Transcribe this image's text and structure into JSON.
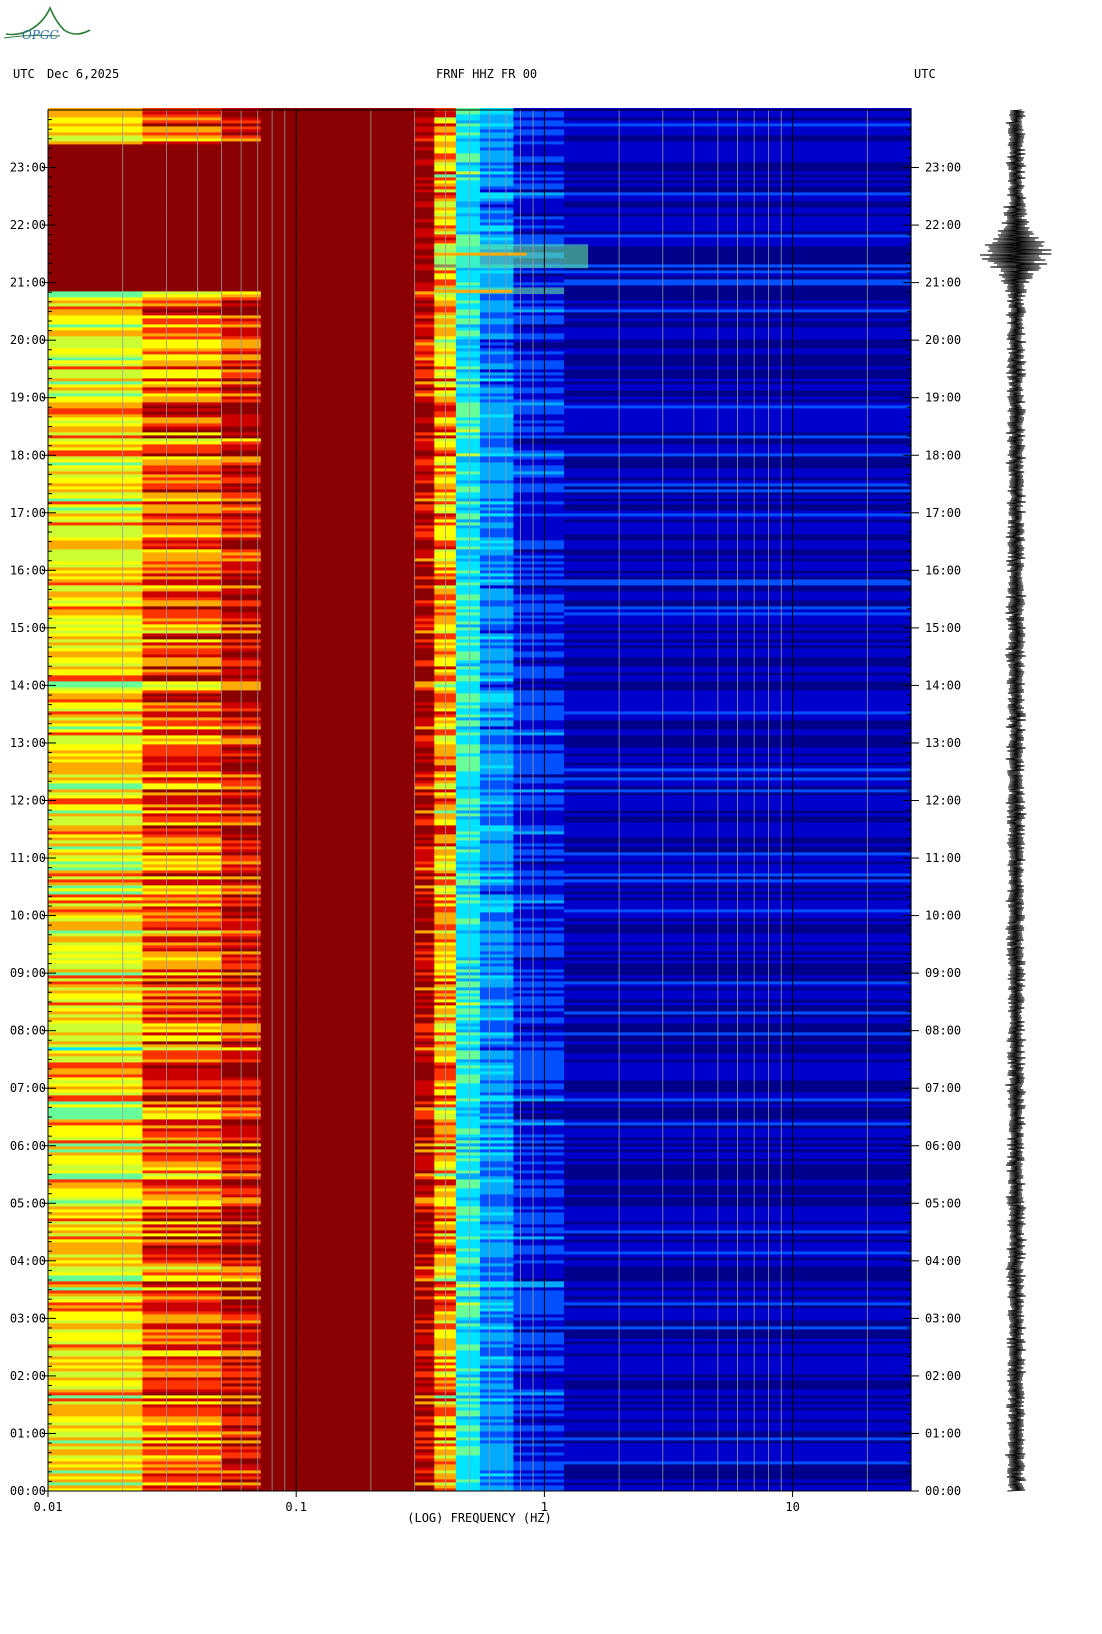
{
  "logo": {
    "text": "OPGC",
    "color": "#2f7d3a"
  },
  "header": {
    "left_tz": "UTC",
    "date": "Dec 6,2025",
    "station": "FRNF HHZ FR 00",
    "right_tz": "UTC"
  },
  "chart_data": {
    "type": "heatmap",
    "title": "FRNF HHZ FR 00",
    "date": "Dec 6,2025",
    "xlabel": "(LOG) FREQUENCY (HZ)",
    "xscale": "log",
    "xlim": [
      0.01,
      30
    ],
    "x_tick_labels": [
      {
        "value": 0.01,
        "label": "0.01"
      },
      {
        "value": 0.1,
        "label": "0.1"
      },
      {
        "value": 1,
        "label": "1"
      },
      {
        "value": 10,
        "label": "10"
      }
    ],
    "ylabel_left": "UTC",
    "ylabel_right": "UTC",
    "ylim_hours": [
      0,
      24
    ],
    "y_tick_labels": [
      "00:00",
      "01:00",
      "02:00",
      "03:00",
      "04:00",
      "05:00",
      "06:00",
      "07:00",
      "08:00",
      "09:00",
      "10:00",
      "11:00",
      "12:00",
      "13:00",
      "14:00",
      "15:00",
      "16:00",
      "17:00",
      "18:00",
      "19:00",
      "20:00",
      "21:00",
      "22:00",
      "23:00"
    ],
    "colormap": [
      "#00008b",
      "#0000cd",
      "#0050ff",
      "#00aaff",
      "#00e5ff",
      "#66ff99",
      "#ccff33",
      "#ffff00",
      "#ffaa00",
      "#ff3300",
      "#cc0000",
      "#8b0000"
    ],
    "frequency_bands": [
      {
        "f_min": 0.01,
        "f_max": 0.024,
        "level": 0.63
      },
      {
        "f_min": 0.024,
        "f_max": 0.05,
        "level": 0.78
      },
      {
        "f_min": 0.05,
        "f_max": 0.072,
        "level": 0.88
      },
      {
        "f_min": 0.072,
        "f_max": 0.3,
        "level": 1.0
      },
      {
        "f_min": 0.3,
        "f_max": 0.36,
        "level": 0.93
      },
      {
        "f_min": 0.36,
        "f_max": 0.44,
        "level": 0.7
      },
      {
        "f_min": 0.44,
        "f_max": 0.55,
        "level": 0.38
      },
      {
        "f_min": 0.55,
        "f_max": 0.75,
        "level": 0.24
      },
      {
        "f_min": 0.75,
        "f_max": 1.2,
        "level": 0.13
      },
      {
        "f_min": 1.2,
        "f_max": 30,
        "level": 0.05
      }
    ],
    "events": [
      {
        "start": "20:50",
        "end": "23:25",
        "f_max": 0.31,
        "note": "saturated"
      },
      {
        "start": "21:15",
        "end": "21:40",
        "f_max": 1.5,
        "note": "energy burst"
      },
      {
        "start": "20:48",
        "end": "20:55",
        "f_max": 1.2,
        "note": "energy burst"
      }
    ]
  },
  "seismogram": {
    "title": "Seismic trace",
    "event_window": [
      "20:50",
      "22:20"
    ],
    "peak_time": "21:30"
  }
}
